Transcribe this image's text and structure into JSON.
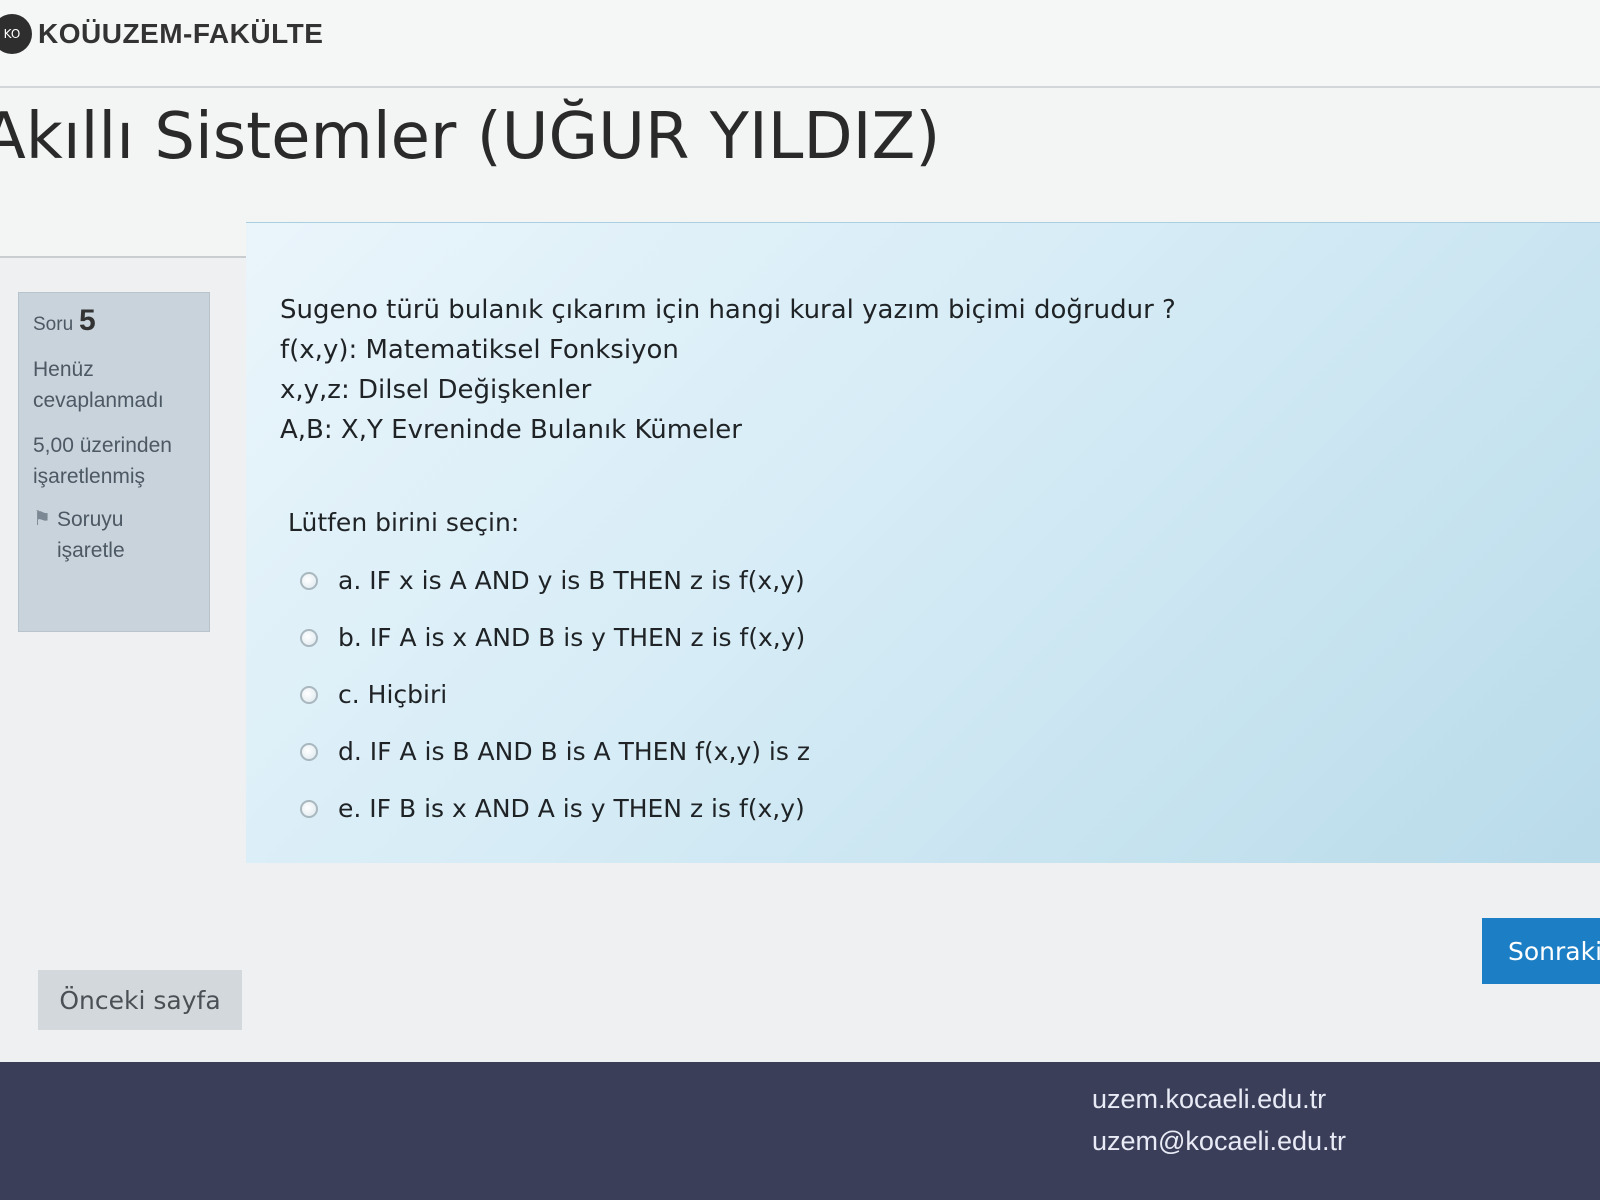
{
  "brand": {
    "logo_text": "KO",
    "name": "KOÜUZEM-FAKÜLTE"
  },
  "course": {
    "title": "Akıllı Sistemler (UĞUR YILDIZ)"
  },
  "question_info": {
    "label": "Soru",
    "number": "5",
    "status": "Henüz cevaplanmadı",
    "mark": "5,00 üzerinden işaretlenmiş",
    "flag_label": "Soruyu işaretle"
  },
  "question": {
    "text_lines": [
      "Sugeno türü bulanık çıkarım için hangi kural yazım biçimi doğrudur ?",
      "f(x,y): Matematiksel Fonksiyon",
      "x,y,z: Dilsel Değişkenler",
      "A,B: X,Y Evreninde Bulanık Kümeler"
    ],
    "prompt": "Lütfen birini seçin:",
    "answers": [
      "a. IF x is A AND y is B THEN z is f(x,y)",
      "b. IF A is x AND B is y THEN z is f(x,y)",
      "c. Hiçbiri",
      "d. IF A is B AND B is A THEN f(x,y) is z",
      "e. IF B is x AND A is y THEN z is f(x,y)"
    ]
  },
  "nav": {
    "prev_label": "Önceki sayfa",
    "next_label": "Sonraki"
  },
  "footer": {
    "site": "uzem.kocaeli.edu.tr",
    "email": "uzem@kocaeli.edu.tr"
  },
  "colors": {
    "primary_button": "#1c7fc5",
    "footer_bg": "#3a3e59",
    "question_bg": "#d6ecf6",
    "info_bg": "#c9d3dc"
  }
}
